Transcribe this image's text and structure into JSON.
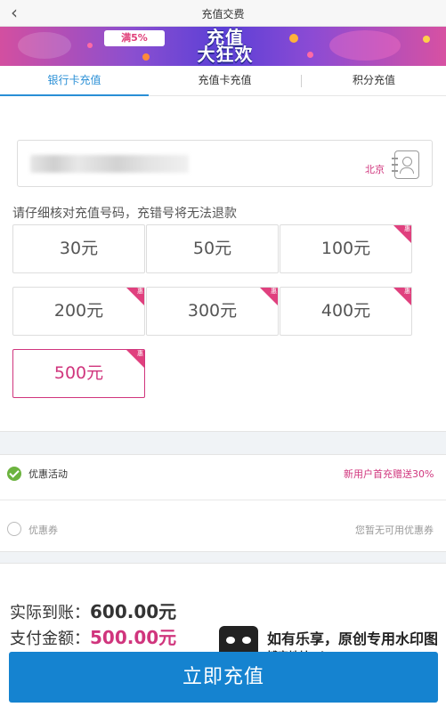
{
  "header": {
    "title": "充值交费",
    "back_icon": "chevron-left-icon"
  },
  "banner": {
    "coupon_text": "满5%",
    "headline_1": "充值",
    "headline_2": "大狂欢"
  },
  "tabs": [
    {
      "label": "银行卡充值",
      "active": true
    },
    {
      "label": "充值卡充值",
      "active": false
    },
    {
      "label": "积分充值",
      "active": false
    }
  ],
  "phone": {
    "value": "",
    "region": "北京",
    "contact_icon": "address-book-icon"
  },
  "hint": "请仔细核对充值号码，充错号将无法退款",
  "amounts": [
    {
      "label": "30元",
      "badge": ""
    },
    {
      "label": "50元",
      "badge": ""
    },
    {
      "label": "100元",
      "badge": "惠"
    },
    {
      "label": "200元",
      "badge": "惠"
    },
    {
      "label": "300元",
      "badge": "惠"
    },
    {
      "label": "400元",
      "badge": "惠"
    },
    {
      "label": "500元",
      "badge": "惠",
      "selected": true
    }
  ],
  "promo": {
    "label": "优惠活动",
    "detail": "新用户首充赠送30%",
    "checked": true
  },
  "voucher": {
    "label": "优惠券",
    "detail": "您暂无可用优惠券",
    "checked": false
  },
  "summary": {
    "received_label": "实际到账：",
    "received_value": "600.00元",
    "pay_label": "支付金额：",
    "pay_value": "500.00元"
  },
  "watermark": {
    "line1": "如有乐享，原创专用水印图",
    "line2": "博客地址：http://51.ruyo.net"
  },
  "submit_label": "立即充值",
  "colors": {
    "accent": "#d0357d",
    "primary": "#1583d0",
    "tab_active": "#2a8fd6",
    "check": "#6cb33f"
  }
}
